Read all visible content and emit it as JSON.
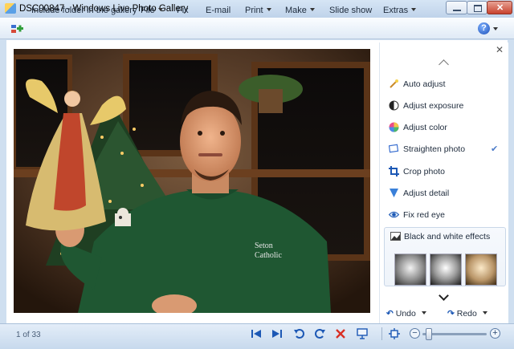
{
  "window": {
    "title": "DSC00847 - Windows Live Photo Gallery"
  },
  "menubar": {
    "include_folder": "Include folder in the gallery",
    "items": [
      "File",
      "Fix",
      "E-mail",
      "Print",
      "Make",
      "Slide show",
      "Extras"
    ]
  },
  "fix_panel": {
    "items": [
      {
        "label": "Auto adjust",
        "icon": "magic-wand-icon"
      },
      {
        "label": "Adjust exposure",
        "icon": "exposure-icon"
      },
      {
        "label": "Adjust color",
        "icon": "color-wheel-icon"
      },
      {
        "label": "Straighten photo",
        "icon": "straighten-icon",
        "checked": true
      },
      {
        "label": "Crop photo",
        "icon": "crop-icon"
      },
      {
        "label": "Adjust detail",
        "icon": "detail-icon"
      },
      {
        "label": "Fix red eye",
        "icon": "eye-icon"
      }
    ],
    "bw_effects": "Black and white effects",
    "undo": "Undo",
    "redo": "Redo"
  },
  "status": {
    "page": "1 of 33"
  },
  "colors": {
    "accent": "#1c58b5",
    "delete": "#d93025",
    "panel_border": "#c9d7e8"
  }
}
